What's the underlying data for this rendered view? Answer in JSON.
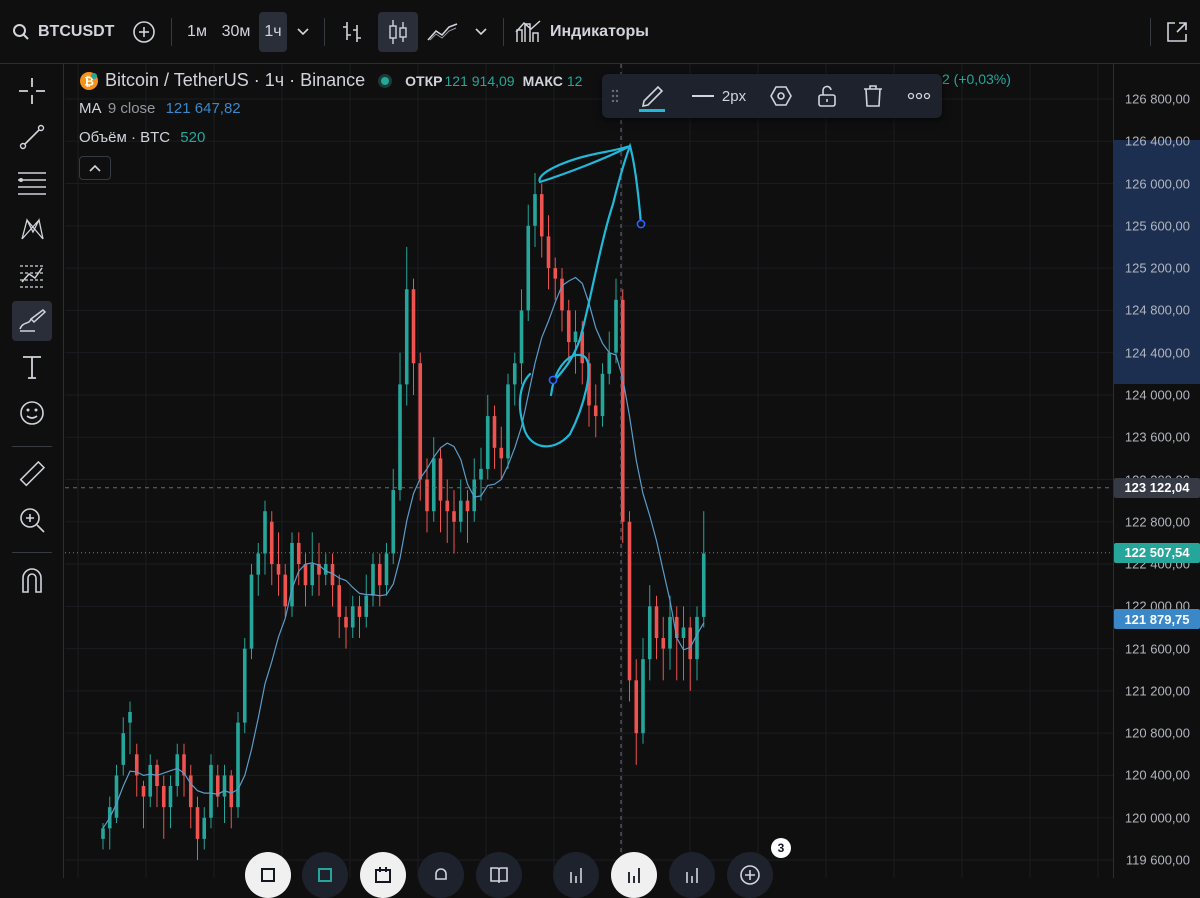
{
  "topbar": {
    "symbol": "BTCUSDT",
    "intervals": [
      "1м",
      "30м",
      "1ч"
    ],
    "active_interval": "1ч",
    "indicators_label": "Индикаторы"
  },
  "legend": {
    "title": "Bitcoin / TetherUS · 1ч · Binance",
    "open_label": "ОТКР",
    "open_value": "121 914,09",
    "high_label": "МАКС",
    "high_value": "12",
    "change_tail": "2 (+0,03%)",
    "ma_label": "MA",
    "ma_params": "9 close",
    "ma_value": "121 647,82",
    "volume_label": "Объём · BTC",
    "volume_value": "520"
  },
  "drawing_toolbar": {
    "line_width_label": "2px"
  },
  "price_axis": {
    "labels": [
      "126 800,00",
      "126 400,00",
      "126 000,00",
      "125 600,00",
      "125 200,00",
      "124 800,00",
      "124 400,00",
      "124 000,00",
      "123 600,00",
      "123 200,00",
      "122 800,00",
      "122 400,00",
      "122 000,00",
      "121 600,00",
      "121 200,00",
      "120 800,00",
      "120 400,00",
      "120 000,00",
      "119 600,00"
    ],
    "crosshair_price": "123 122,04",
    "last_price": "122 507,54",
    "ma_price": "121 879,75"
  },
  "bottom_bar": {
    "badge_count": "3"
  },
  "colors": {
    "up": "#26a69a",
    "down": "#ef5350",
    "ma_line": "#5b9cc9",
    "drawing": "#22b8d8",
    "last_price_tag": "#26a69a",
    "ma_tag": "#3a88c8",
    "crosshair_tag": "#363a45",
    "highlight_band": "#1c2f50"
  },
  "chart_data": {
    "type": "candlestick",
    "y_range": [
      119600,
      126800
    ],
    "candles": [
      [
        119800,
        119900,
        119700,
        119950
      ],
      [
        119900,
        120100,
        119700,
        120200
      ],
      [
        120000,
        120400,
        119950,
        120500
      ],
      [
        120500,
        120800,
        120400,
        120950
      ],
      [
        120900,
        121000,
        120600,
        121100
      ],
      [
        120600,
        120400,
        120200,
        120700
      ],
      [
        120300,
        120200,
        119900,
        120350
      ],
      [
        120200,
        120500,
        120100,
        120600
      ],
      [
        120500,
        120300,
        120100,
        120550
      ],
      [
        120300,
        120100,
        119800,
        120400
      ],
      [
        120100,
        120300,
        119900,
        120400
      ],
      [
        120300,
        120600,
        120200,
        120700
      ],
      [
        120600,
        120400,
        120200,
        120700
      ],
      [
        120400,
        120100,
        119900,
        120500
      ],
      [
        120100,
        119800,
        119600,
        120200
      ],
      [
        119800,
        120000,
        119700,
        120100
      ],
      [
        120000,
        120500,
        119900,
        120600
      ],
      [
        120400,
        120200,
        120100,
        120500
      ],
      [
        120200,
        120400,
        119950,
        120500
      ],
      [
        120400,
        120100,
        119900,
        120450
      ],
      [
        120100,
        120900,
        120000,
        121000
      ],
      [
        120900,
        121600,
        120800,
        121700
      ],
      [
        121600,
        122300,
        121500,
        122400
      ],
      [
        122300,
        122500,
        122100,
        122600
      ],
      [
        122500,
        122900,
        122300,
        123000
      ],
      [
        122800,
        122400,
        122200,
        122900
      ],
      [
        122400,
        122300,
        122100,
        122700
      ],
      [
        122300,
        122000,
        121900,
        122400
      ],
      [
        122000,
        122600,
        121900,
        122700
      ],
      [
        122600,
        122400,
        122200,
        122700
      ],
      [
        122400,
        122200,
        122000,
        122500
      ],
      [
        122200,
        122400,
        122100,
        122700
      ],
      [
        122400,
        122300,
        122100,
        122600
      ],
      [
        122300,
        122400,
        122200,
        122500
      ],
      [
        122400,
        122200,
        122000,
        122500
      ],
      [
        122200,
        121900,
        121700,
        122300
      ],
      [
        121900,
        121800,
        121600,
        122000
      ],
      [
        121800,
        122000,
        121700,
        122100
      ],
      [
        122000,
        121900,
        121700,
        122100
      ],
      [
        121900,
        122100,
        121800,
        122300
      ],
      [
        122100,
        122400,
        122000,
        122500
      ],
      [
        122400,
        122200,
        122000,
        122500
      ],
      [
        122200,
        122500,
        122100,
        122600
      ],
      [
        122500,
        123100,
        122400,
        123300
      ],
      [
        123100,
        124100,
        123000,
        124400
      ],
      [
        124100,
        125000,
        123900,
        125400
      ],
      [
        125000,
        124300,
        124000,
        125100
      ],
      [
        124300,
        123200,
        123000,
        124400
      ],
      [
        123200,
        122900,
        122700,
        123400
      ],
      [
        122900,
        123400,
        122800,
        123600
      ],
      [
        123400,
        123000,
        122700,
        123500
      ],
      [
        123000,
        122900,
        122600,
        123200
      ],
      [
        122900,
        122800,
        122500,
        123100
      ],
      [
        122800,
        123000,
        122700,
        123200
      ],
      [
        123000,
        122900,
        122600,
        123100
      ],
      [
        122900,
        123200,
        122800,
        123400
      ],
      [
        123200,
        123300,
        123000,
        123500
      ],
      [
        123300,
        123800,
        123200,
        124000
      ],
      [
        123800,
        123500,
        123300,
        123900
      ],
      [
        123500,
        123400,
        123200,
        123700
      ],
      [
        123400,
        124100,
        123300,
        124200
      ],
      [
        124100,
        124300,
        123900,
        124400
      ],
      [
        124300,
        124800,
        124100,
        125000
      ],
      [
        124800,
        125600,
        124700,
        125800
      ],
      [
        125600,
        125900,
        125400,
        126100
      ],
      [
        125900,
        125500,
        125300,
        126000
      ],
      [
        125500,
        125200,
        125000,
        125700
      ],
      [
        125200,
        125100,
        124900,
        125300
      ],
      [
        125100,
        124800,
        124600,
        125200
      ],
      [
        124800,
        124500,
        124300,
        124900
      ],
      [
        124500,
        124600,
        124200,
        124800
      ],
      [
        124600,
        124300,
        124100,
        124700
      ],
      [
        124300,
        123900,
        123700,
        124400
      ],
      [
        123900,
        123800,
        123600,
        124100
      ],
      [
        123800,
        124200,
        123700,
        124300
      ],
      [
        124200,
        124400,
        124100,
        124600
      ],
      [
        124400,
        124900,
        124300,
        125100
      ],
      [
        124900,
        122800,
        122600,
        125000
      ],
      [
        122800,
        121300,
        121100,
        122900
      ],
      [
        121300,
        120800,
        120500,
        121500
      ],
      [
        120800,
        121500,
        120700,
        121700
      ],
      [
        121500,
        122000,
        121300,
        122200
      ],
      [
        122000,
        121700,
        121500,
        122100
      ],
      [
        121700,
        121600,
        121300,
        121900
      ],
      [
        121600,
        121900,
        121400,
        122100
      ],
      [
        121900,
        121700,
        121300,
        122000
      ],
      [
        121700,
        121800,
        121300,
        122000
      ],
      [
        121800,
        121500,
        121200,
        121900
      ],
      [
        121500,
        121900,
        121300,
        122000
      ],
      [
        121900,
        122500,
        121800,
        122900
      ]
    ]
  }
}
